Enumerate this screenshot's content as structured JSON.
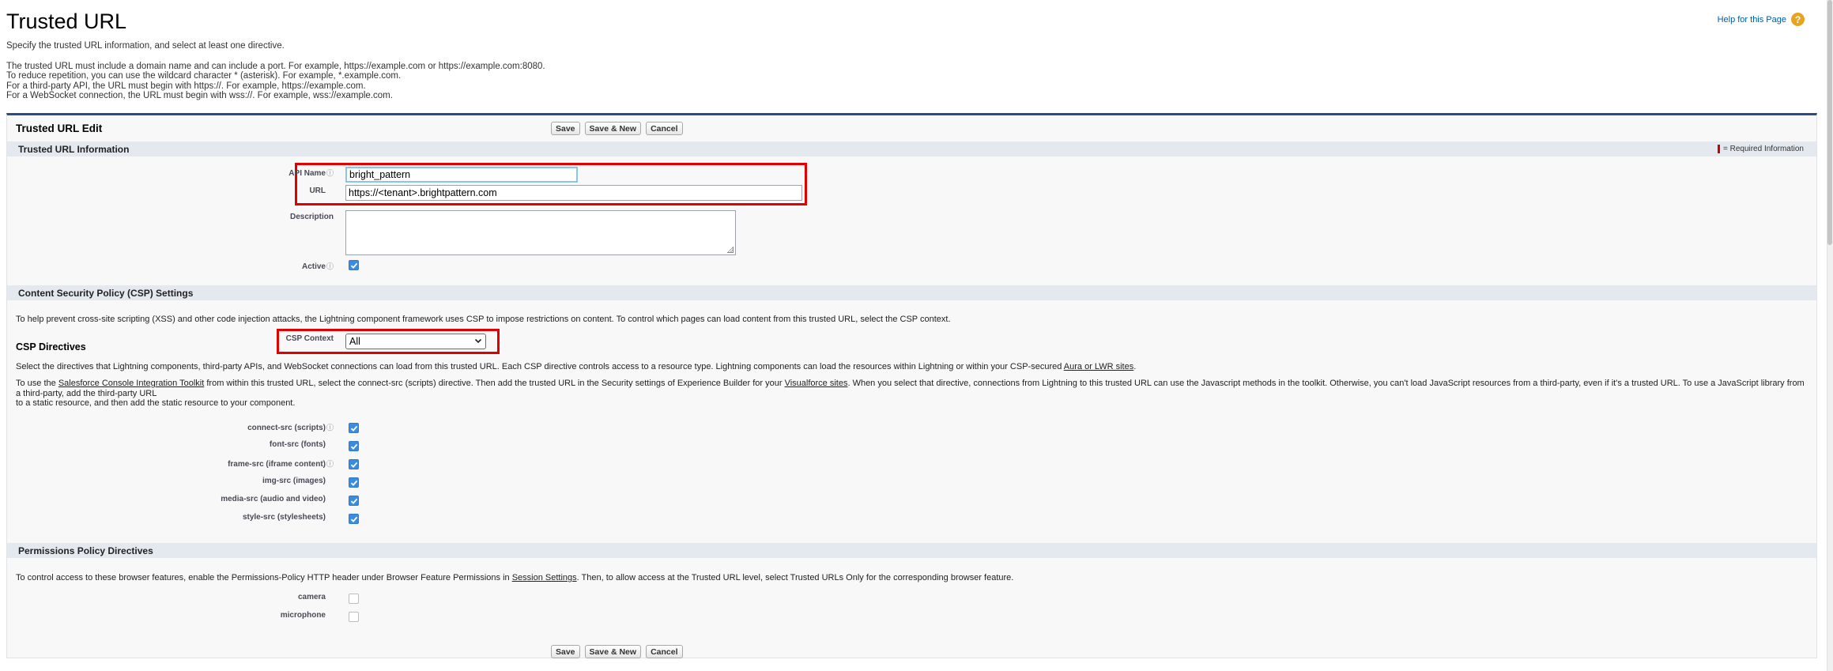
{
  "page": {
    "title": "Trusted URL",
    "help_link": "Help for this Page",
    "help_icon": "question-icon",
    "intro": {
      "line1": "Specify the trusted URL information, and select at least one directive.",
      "line2": "The trusted URL must include a domain name and can include a port. For example, https://example.com or https://example.com:8080.",
      "line3": "To reduce repetition, you can use the wildcard character * (asterisk). For example, *.example.com.",
      "line4": "For a third-party API, the URL must begin with https://. For example, https://example.com.",
      "line5": "For a WebSocket connection, the URL must begin with wss://. For example, wss://example.com."
    }
  },
  "edit": {
    "title": "Trusted URL Edit",
    "buttons": {
      "save": "Save",
      "save_new": "Save & New",
      "cancel": "Cancel"
    }
  },
  "info_section": {
    "title": "Trusted URL Information",
    "required_info": "= Required Information",
    "api_name_label": "API Name",
    "api_name_value": "bright_pattern",
    "url_label": "URL",
    "url_value": "https://<tenant>.brightpattern.com",
    "description_label": "Description",
    "description_value": "",
    "active_label": "Active",
    "active_checked": true
  },
  "csp_section": {
    "title": "Content Security Policy (CSP) Settings",
    "intro": "To help prevent cross-site scripting (XSS) and other code injection attacks, the Lightning component framework uses CSP to impose restrictions on content. To control which pages can load content from this trusted URL, select the CSP context.",
    "context_label": "CSP Context",
    "context_value": "All",
    "directives_title": "CSP Directives",
    "directives_text_a": "Select the directives that Lightning components, third-party APIs, and WebSocket connections can load from this trusted URL. Each CSP directive controls access to a resource type. Lightning components can load the resources within Lightning or within your CSP-secured ",
    "directives_link": "Aura or LWR sites",
    "directives_text_b": ".",
    "toolkit_text_a": "To use the ",
    "toolkit_link": "Salesforce Console Integration Toolkit",
    "toolkit_text_b": " from within this trusted URL, select the connect-src (scripts) directive. Then add the trusted URL in the Security settings of Experience Builder for your ",
    "toolkit_link2": "Visualforce sites",
    "toolkit_text_c": ". When you select that directive, connections from Lightning to this trusted URL can use the Javascript methods in the toolkit. Otherwise, you can't load JavaScript resources from a third-party, even if it's a trusted URL. To use a JavaScript library from a third-party, add the third-party URL",
    "toolkit_text_d": "to a static resource, and then add the static resource to your component.",
    "directives": [
      {
        "label": "connect-src (scripts)",
        "checked": true,
        "info": true
      },
      {
        "label": "font-src (fonts)",
        "checked": true,
        "info": false
      },
      {
        "label": "frame-src (iframe content)",
        "checked": true,
        "info": true
      },
      {
        "label": "img-src (images)",
        "checked": true,
        "info": false
      },
      {
        "label": "media-src (audio and video)",
        "checked": true,
        "info": false
      },
      {
        "label": "style-src (stylesheets)",
        "checked": true,
        "info": false
      }
    ]
  },
  "permissions_section": {
    "title": "Permissions Policy Directives",
    "text_a": "To control access to these browser features, enable the Permissions-Policy HTTP header under Browser Feature Permissions in ",
    "link": "Session Settings",
    "text_b": ". Then, to allow access at the Trusted URL level, select Trusted URLs Only for the corresponding browser feature.",
    "items": [
      {
        "label": "camera",
        "checked": false
      },
      {
        "label": "microphone",
        "checked": false
      }
    ]
  },
  "colors": {
    "accent_border": "#2a4d84",
    "section_bar": "#e4e9f0",
    "highlight": "#e00000",
    "checkbox": "#3a8dde"
  }
}
